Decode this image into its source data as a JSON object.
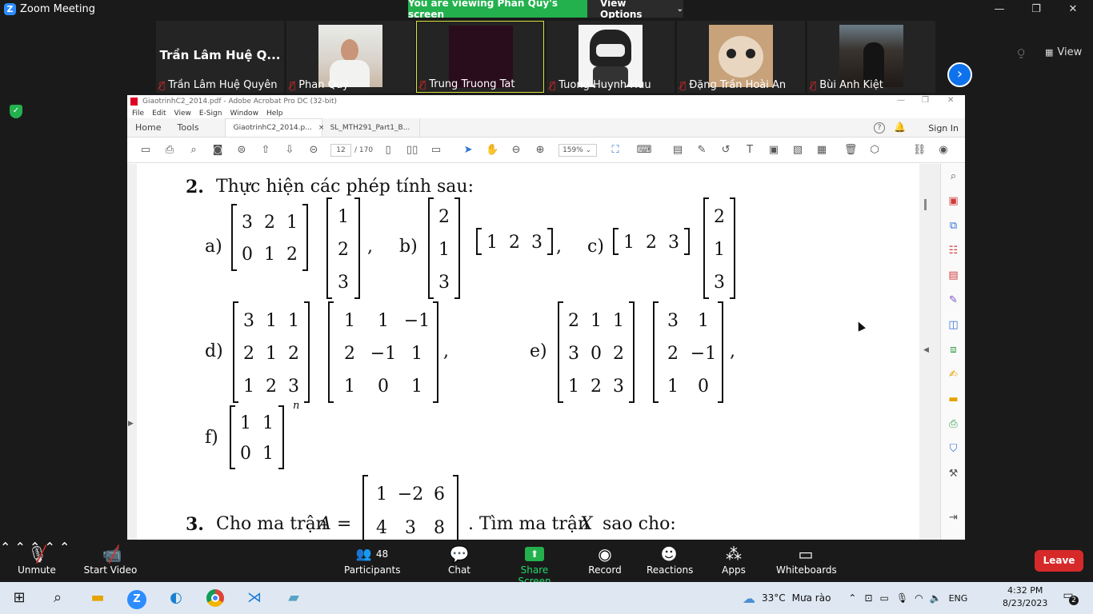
{
  "zoom": {
    "app_title": "Zoom Meeting",
    "viewing_banner": "You are viewing Phan Quý's screen",
    "view_options": "View Options",
    "view_button": "View",
    "participants": [
      {
        "name": "Trần Lâm Huệ Quyên",
        "big_name": "Trần Lâm Huệ Q...",
        "type": "name-only"
      },
      {
        "name": "Phan Quý",
        "type": "video"
      },
      {
        "name": "Trung Truong Tat",
        "type": "dark",
        "active": true
      },
      {
        "name": "Tuong Huynh Huu",
        "type": "avatar-robot"
      },
      {
        "name": "Đặng Trần Hoài An",
        "type": "avatar-cat"
      },
      {
        "name": "Bùi Anh Kiệt",
        "type": "photo"
      }
    ],
    "toolbar": {
      "unmute": "Unmute",
      "start_video": "Start Video",
      "participants": "Participants",
      "participants_count": "48",
      "chat": "Chat",
      "share_screen": "Share Screen",
      "record": "Record",
      "reactions": "Reactions",
      "apps": "Apps",
      "whiteboards": "Whiteboards",
      "leave": "Leave"
    }
  },
  "acrobat": {
    "window_title": "GiaotrinhC2_2014.pdf - Adobe Acrobat Pro DC (32-bit)",
    "menu": [
      "File",
      "Edit",
      "View",
      "E-Sign",
      "Window",
      "Help"
    ],
    "tabs": {
      "home": "Home",
      "tools": "Tools",
      "doc1": "GiaotrinhC2_2014.p...",
      "doc2": "SL_MTH291_Part1_B..."
    },
    "sign_in": "Sign In",
    "page_current": "12",
    "page_total": "/ 170",
    "zoom": "159%"
  },
  "doc": {
    "ex2_num": "2.",
    "ex2_title": "Thực hiện các phép tính sau:",
    "ex3_num": "3.",
    "ex3_text_a": "Cho ma trận",
    "ex3_var": "A =",
    "ex3_text_b": ". Tìm ma trận",
    "ex3_var2": "X",
    "ex3_text_c": "sao cho:",
    "labels": {
      "a": "a)",
      "b": "b)",
      "c": "c)",
      "d": "d)",
      "e": "e)",
      "f": "f)"
    },
    "exponent": "n",
    "matrices": {
      "a1": [
        [
          "3",
          "2",
          "1"
        ],
        [
          "0",
          "1",
          "2"
        ]
      ],
      "a2": [
        [
          "1"
        ],
        [
          "2"
        ],
        [
          "3"
        ]
      ],
      "b1": [
        [
          "2"
        ],
        [
          "1"
        ],
        [
          "3"
        ]
      ],
      "b2": [
        [
          "1",
          "2",
          "3"
        ]
      ],
      "c1": [
        [
          "1",
          "2",
          "3"
        ]
      ],
      "c2": [
        [
          "2"
        ],
        [
          "1"
        ],
        [
          "3"
        ]
      ],
      "d1": [
        [
          "3",
          "1",
          "1"
        ],
        [
          "2",
          "1",
          "2"
        ],
        [
          "1",
          "2",
          "3"
        ]
      ],
      "d2": [
        [
          "1",
          "1",
          "−1"
        ],
        [
          "2",
          "−1",
          "1"
        ],
        [
          "1",
          "0",
          "1"
        ]
      ],
      "e1": [
        [
          "2",
          "1",
          "1"
        ],
        [
          "3",
          "0",
          "2"
        ],
        [
          "1",
          "2",
          "3"
        ]
      ],
      "e2": [
        [
          "3",
          "1"
        ],
        [
          "2",
          "−1"
        ],
        [
          "1",
          "0"
        ]
      ],
      "f1": [
        [
          "1",
          "1"
        ],
        [
          "0",
          "1"
        ]
      ],
      "A": [
        [
          "1",
          "−2",
          "6"
        ],
        [
          "4",
          "3",
          "8"
        ]
      ]
    }
  },
  "taskbar": {
    "weather_temp": "33°C",
    "weather_text": "Mưa rào",
    "language": "ENG",
    "time": "4:32 PM",
    "date": "8/23/2023",
    "notifications": "2"
  }
}
